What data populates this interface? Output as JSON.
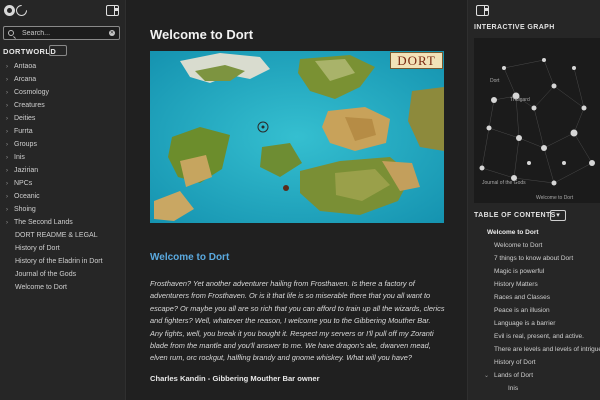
{
  "sidebar": {
    "search_placeholder": "Search...",
    "site_title": "DORTWORLD",
    "folders": [
      "Antaoa",
      "Arcana",
      "Cosmology",
      "Creatures",
      "Deities",
      "Furrta",
      "Groups",
      "Inis",
      "Jazirian",
      "NPCs",
      "Oceanic",
      "Shoing",
      "The Second Lands"
    ],
    "pages": [
      "DORT README & LEGAL",
      "History of Dort",
      "History of the Eladrin in Dort",
      "Journal of the Gods",
      "Welcome to Dort"
    ]
  },
  "main": {
    "title": "Welcome to Dort",
    "map_badge": "DORT",
    "heading": "Welcome to Dort",
    "paragraph": "Frosthaven? Yet another adventurer hailing from Frosthaven. Is there a factory of adventurers from Frosthaven. Or is it that life is so miserable there that you all want to escape? Or maybe you all are so rich that you can afford to train up all the wizards, clerics and fighters? Well, whatever the reason, I welcome you to the Gibbering Mouther Bar. Any fights, well, you break it you bought it. Respect my servers or I'll pull off my Zoranti blade from the mantle and you'll answer to me. We have dragon's ale, dwarven mead, elven rum, orc rockgut, halfling brandy and gnome whiskey. What will you have?",
    "signature": "Charles Kandin - Gibbering Mouther Bar owner"
  },
  "right": {
    "graph_title": "INTERACTIVE GRAPH",
    "graph_labels": [
      "Dort",
      "Thulgard",
      "Journal of the Gods",
      "Welcome to Dort"
    ],
    "toc_title": "TABLE OF CONTENTS",
    "toc_toggle": "▾",
    "toc": [
      {
        "label": "Welcome to Dort",
        "level": "lv0"
      },
      {
        "label": "Welcome to Dort",
        "level": "lv1"
      },
      {
        "label": "7 things to know about Dort",
        "level": "lv1"
      },
      {
        "label": "Magic is powerful",
        "level": "lv1"
      },
      {
        "label": "History Matters",
        "level": "lv1"
      },
      {
        "label": "Races and Classes",
        "level": "lv1"
      },
      {
        "label": "Peace is an illusion",
        "level": "lv1"
      },
      {
        "label": "Language is a barrier",
        "level": "lv1"
      },
      {
        "label": "Evil is real, present, and active.",
        "level": "lv1"
      },
      {
        "label": "There are levels and levels of intrigue",
        "level": "lv1"
      },
      {
        "label": "History of Dort",
        "level": "lv1"
      },
      {
        "label": "Lands of Dort",
        "level": "lv1c"
      },
      {
        "label": "Inis",
        "level": "lv2"
      }
    ]
  },
  "colors": {
    "accent": "#5aa9df",
    "ocean": "#1fa9c0",
    "land": "#6f8a2e",
    "desert": "#c9a35c",
    "snow": "#e6e6de"
  }
}
